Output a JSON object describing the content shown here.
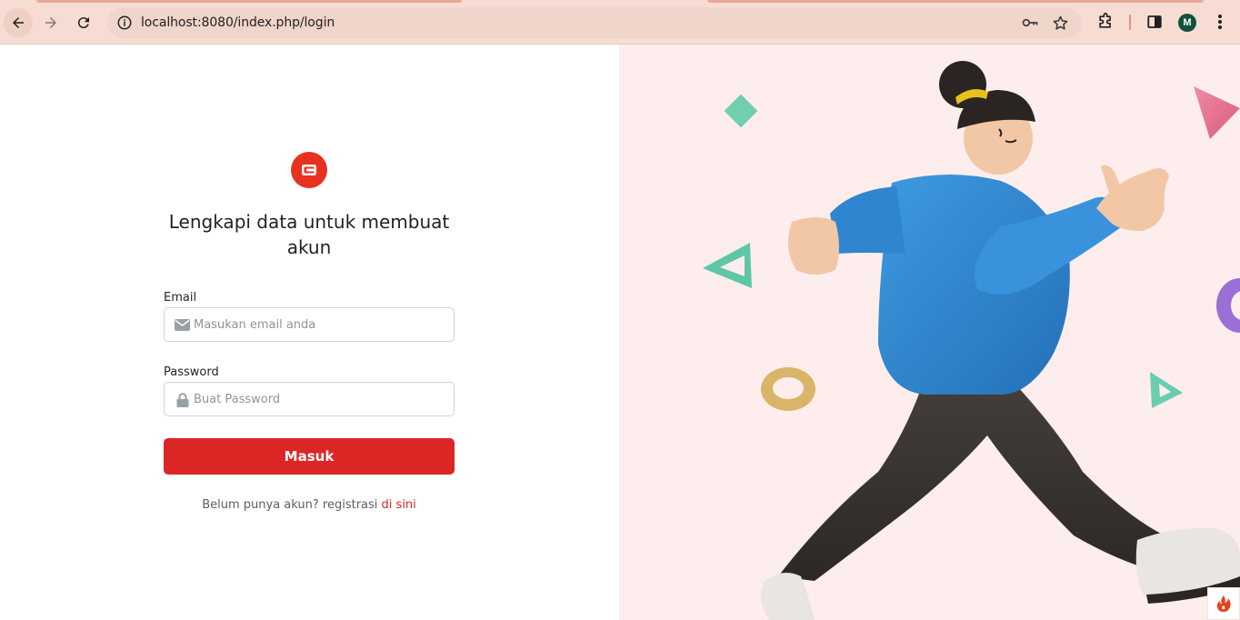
{
  "browser": {
    "url": "localhost:8080/index.php/login",
    "profile_initial": "M"
  },
  "login": {
    "heading": "Lengkapi data untuk membuat akun",
    "email": {
      "label": "Email",
      "placeholder": "Masukan email anda"
    },
    "password": {
      "label": "Password",
      "placeholder": "Buat Password"
    },
    "submit_label": "Masuk",
    "register_prompt": "Belum punya akun? registrasi",
    "register_link": "di sini"
  },
  "colors": {
    "brand_red": "#dc2626",
    "logo_red": "#e8321f",
    "illustration_background": "#fdeeed",
    "chrome_background": "#f7dcd3"
  },
  "icons": {
    "email_field": "envelope-icon",
    "password_field": "lock-icon",
    "logo": "wallet-icon",
    "footer_badge": "flame-icon"
  }
}
